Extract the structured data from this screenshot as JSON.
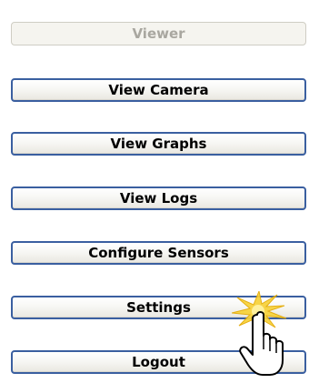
{
  "menu": {
    "viewer_label": "Viewer",
    "view_camera_label": "View Camera",
    "view_graphs_label": "View Graphs",
    "view_logs_label": "View Logs",
    "configure_sensors_label": "Configure Sensors",
    "settings_label": "Settings",
    "logout_label": "Logout"
  },
  "pointer": {
    "icon": "hand-pointer-icon",
    "highlight_icon": "click-burst-icon",
    "highlight_color": "#f2c200"
  }
}
